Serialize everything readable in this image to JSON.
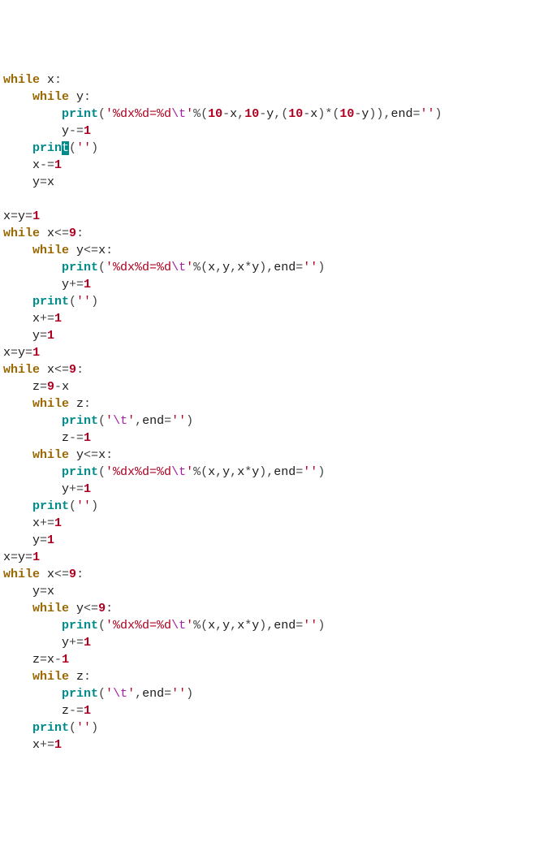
{
  "code_tokens": [
    [
      [
        "kw",
        "while"
      ],
      [
        "id",
        " x"
      ],
      [
        "op",
        ":"
      ]
    ],
    [
      [
        "id",
        "    "
      ],
      [
        "kw",
        "while"
      ],
      [
        "id",
        " y"
      ],
      [
        "op",
        ":"
      ]
    ],
    [
      [
        "id",
        "        "
      ],
      [
        "fn",
        "print"
      ],
      [
        "paren",
        "("
      ],
      [
        "str",
        "'%dx%d=%d"
      ],
      [
        "esc",
        "\\t"
      ],
      [
        "str",
        "'"
      ],
      [
        "op",
        "%"
      ],
      [
        "paren",
        "("
      ],
      [
        "num",
        "10"
      ],
      [
        "op",
        "-"
      ],
      [
        "id",
        "x"
      ],
      [
        "op",
        ","
      ],
      [
        "num",
        "10"
      ],
      [
        "op",
        "-"
      ],
      [
        "id",
        "y"
      ],
      [
        "op",
        ","
      ],
      [
        "paren",
        "("
      ],
      [
        "num",
        "10"
      ],
      [
        "op",
        "-"
      ],
      [
        "id",
        "x"
      ],
      [
        "paren",
        ")"
      ],
      [
        "op",
        "*"
      ],
      [
        "paren",
        "("
      ],
      [
        "num",
        "10"
      ],
      [
        "op",
        "-"
      ],
      [
        "id",
        "y"
      ],
      [
        "paren",
        ")"
      ],
      [
        "paren",
        ")"
      ],
      [
        "op",
        ","
      ],
      [
        "id",
        "end"
      ],
      [
        "op",
        "="
      ],
      [
        "str",
        "''"
      ],
      [
        "paren",
        ")"
      ]
    ],
    [
      [
        "id",
        "        y"
      ],
      [
        "op",
        "-="
      ],
      [
        "num",
        "1"
      ]
    ],
    [
      [
        "id",
        "    "
      ],
      [
        "fn",
        "prin"
      ],
      [
        "highlight",
        "t"
      ],
      [
        "paren",
        "("
      ],
      [
        "str",
        "''"
      ],
      [
        "paren",
        ")"
      ]
    ],
    [
      [
        "id",
        "    x"
      ],
      [
        "op",
        "-="
      ],
      [
        "num",
        "1"
      ]
    ],
    [
      [
        "id",
        "    y"
      ],
      [
        "op",
        "="
      ],
      [
        "id",
        "x"
      ]
    ],
    [],
    [
      [
        "id",
        "x"
      ],
      [
        "op",
        "="
      ],
      [
        "id",
        "y"
      ],
      [
        "op",
        "="
      ],
      [
        "num",
        "1"
      ]
    ],
    [
      [
        "kw",
        "while"
      ],
      [
        "id",
        " x"
      ],
      [
        "op",
        "<="
      ],
      [
        "num",
        "9"
      ],
      [
        "op",
        ":"
      ]
    ],
    [
      [
        "id",
        "    "
      ],
      [
        "kw",
        "while"
      ],
      [
        "id",
        " y"
      ],
      [
        "op",
        "<="
      ],
      [
        "id",
        "x"
      ],
      [
        "op",
        ":"
      ]
    ],
    [
      [
        "id",
        "        "
      ],
      [
        "fn",
        "print"
      ],
      [
        "paren",
        "("
      ],
      [
        "str",
        "'%dx%d=%d"
      ],
      [
        "esc",
        "\\t"
      ],
      [
        "str",
        "'"
      ],
      [
        "op",
        "%"
      ],
      [
        "paren",
        "("
      ],
      [
        "id",
        "x"
      ],
      [
        "op",
        ","
      ],
      [
        "id",
        "y"
      ],
      [
        "op",
        ","
      ],
      [
        "id",
        "x"
      ],
      [
        "op",
        "*"
      ],
      [
        "id",
        "y"
      ],
      [
        "paren",
        ")"
      ],
      [
        "op",
        ","
      ],
      [
        "id",
        "end"
      ],
      [
        "op",
        "="
      ],
      [
        "str",
        "''"
      ],
      [
        "paren",
        ")"
      ]
    ],
    [
      [
        "id",
        "        y"
      ],
      [
        "op",
        "+="
      ],
      [
        "num",
        "1"
      ]
    ],
    [
      [
        "id",
        "    "
      ],
      [
        "fn",
        "print"
      ],
      [
        "paren",
        "("
      ],
      [
        "str",
        "''"
      ],
      [
        "paren",
        ")"
      ]
    ],
    [
      [
        "id",
        "    x"
      ],
      [
        "op",
        "+="
      ],
      [
        "num",
        "1"
      ]
    ],
    [
      [
        "id",
        "    y"
      ],
      [
        "op",
        "="
      ],
      [
        "num",
        "1"
      ]
    ],
    [
      [
        "id",
        "x"
      ],
      [
        "op",
        "="
      ],
      [
        "id",
        "y"
      ],
      [
        "op",
        "="
      ],
      [
        "num",
        "1"
      ]
    ],
    [
      [
        "kw",
        "while"
      ],
      [
        "id",
        " x"
      ],
      [
        "op",
        "<="
      ],
      [
        "num",
        "9"
      ],
      [
        "op",
        ":"
      ]
    ],
    [
      [
        "id",
        "    z"
      ],
      [
        "op",
        "="
      ],
      [
        "num",
        "9"
      ],
      [
        "op",
        "-"
      ],
      [
        "id",
        "x"
      ]
    ],
    [
      [
        "id",
        "    "
      ],
      [
        "kw",
        "while"
      ],
      [
        "id",
        " z"
      ],
      [
        "op",
        ":"
      ]
    ],
    [
      [
        "id",
        "        "
      ],
      [
        "fn",
        "print"
      ],
      [
        "paren",
        "("
      ],
      [
        "str",
        "'"
      ],
      [
        "esc",
        "\\t"
      ],
      [
        "str",
        "'"
      ],
      [
        "op",
        ","
      ],
      [
        "id",
        "end"
      ],
      [
        "op",
        "="
      ],
      [
        "str",
        "''"
      ],
      [
        "paren",
        ")"
      ]
    ],
    [
      [
        "id",
        "        z"
      ],
      [
        "op",
        "-="
      ],
      [
        "num",
        "1"
      ]
    ],
    [
      [
        "id",
        "    "
      ],
      [
        "kw",
        "while"
      ],
      [
        "id",
        " y"
      ],
      [
        "op",
        "<="
      ],
      [
        "id",
        "x"
      ],
      [
        "op",
        ":"
      ]
    ],
    [
      [
        "id",
        "        "
      ],
      [
        "fn",
        "print"
      ],
      [
        "paren",
        "("
      ],
      [
        "str",
        "'%dx%d=%d"
      ],
      [
        "esc",
        "\\t"
      ],
      [
        "str",
        "'"
      ],
      [
        "op",
        "%"
      ],
      [
        "paren",
        "("
      ],
      [
        "id",
        "x"
      ],
      [
        "op",
        ","
      ],
      [
        "id",
        "y"
      ],
      [
        "op",
        ","
      ],
      [
        "id",
        "x"
      ],
      [
        "op",
        "*"
      ],
      [
        "id",
        "y"
      ],
      [
        "paren",
        ")"
      ],
      [
        "op",
        ","
      ],
      [
        "id",
        "end"
      ],
      [
        "op",
        "="
      ],
      [
        "str",
        "''"
      ],
      [
        "paren",
        ")"
      ]
    ],
    [
      [
        "id",
        "        y"
      ],
      [
        "op",
        "+="
      ],
      [
        "num",
        "1"
      ]
    ],
    [
      [
        "id",
        "    "
      ],
      [
        "fn",
        "print"
      ],
      [
        "paren",
        "("
      ],
      [
        "str",
        "''"
      ],
      [
        "paren",
        ")"
      ]
    ],
    [
      [
        "id",
        "    x"
      ],
      [
        "op",
        "+="
      ],
      [
        "num",
        "1"
      ]
    ],
    [
      [
        "id",
        "    y"
      ],
      [
        "op",
        "="
      ],
      [
        "num",
        "1"
      ]
    ],
    [
      [
        "id",
        "x"
      ],
      [
        "op",
        "="
      ],
      [
        "id",
        "y"
      ],
      [
        "op",
        "="
      ],
      [
        "num",
        "1"
      ]
    ],
    [
      [
        "kw",
        "while"
      ],
      [
        "id",
        " x"
      ],
      [
        "op",
        "<="
      ],
      [
        "num",
        "9"
      ],
      [
        "op",
        ":"
      ]
    ],
    [
      [
        "id",
        "    y"
      ],
      [
        "op",
        "="
      ],
      [
        "id",
        "x"
      ]
    ],
    [
      [
        "id",
        "    "
      ],
      [
        "kw",
        "while"
      ],
      [
        "id",
        " y"
      ],
      [
        "op",
        "<="
      ],
      [
        "num",
        "9"
      ],
      [
        "op",
        ":"
      ]
    ],
    [
      [
        "id",
        "        "
      ],
      [
        "fn",
        "print"
      ],
      [
        "paren",
        "("
      ],
      [
        "str",
        "'%dx%d=%d"
      ],
      [
        "esc",
        "\\t"
      ],
      [
        "str",
        "'"
      ],
      [
        "op",
        "%"
      ],
      [
        "paren",
        "("
      ],
      [
        "id",
        "x"
      ],
      [
        "op",
        ","
      ],
      [
        "id",
        "y"
      ],
      [
        "op",
        ","
      ],
      [
        "id",
        "x"
      ],
      [
        "op",
        "*"
      ],
      [
        "id",
        "y"
      ],
      [
        "paren",
        ")"
      ],
      [
        "op",
        ","
      ],
      [
        "id",
        "end"
      ],
      [
        "op",
        "="
      ],
      [
        "str",
        "''"
      ],
      [
        "paren",
        ")"
      ]
    ],
    [
      [
        "id",
        "        y"
      ],
      [
        "op",
        "+="
      ],
      [
        "num",
        "1"
      ]
    ],
    [
      [
        "id",
        "    z"
      ],
      [
        "op",
        "="
      ],
      [
        "id",
        "x"
      ],
      [
        "op",
        "-"
      ],
      [
        "num",
        "1"
      ]
    ],
    [
      [
        "id",
        "    "
      ],
      [
        "kw",
        "while"
      ],
      [
        "id",
        " z"
      ],
      [
        "op",
        ":"
      ]
    ],
    [
      [
        "id",
        "        "
      ],
      [
        "fn",
        "print"
      ],
      [
        "paren",
        "("
      ],
      [
        "str",
        "'"
      ],
      [
        "esc",
        "\\t"
      ],
      [
        "str",
        "'"
      ],
      [
        "op",
        ","
      ],
      [
        "id",
        "end"
      ],
      [
        "op",
        "="
      ],
      [
        "str",
        "''"
      ],
      [
        "paren",
        ")"
      ]
    ],
    [
      [
        "id",
        "        z"
      ],
      [
        "op",
        "-="
      ],
      [
        "num",
        "1"
      ]
    ],
    [
      [
        "id",
        "    "
      ],
      [
        "fn",
        "print"
      ],
      [
        "paren",
        "("
      ],
      [
        "str",
        "''"
      ],
      [
        "paren",
        ")"
      ]
    ],
    [
      [
        "id",
        "    x"
      ],
      [
        "op",
        "+="
      ],
      [
        "num",
        "1"
      ]
    ]
  ]
}
